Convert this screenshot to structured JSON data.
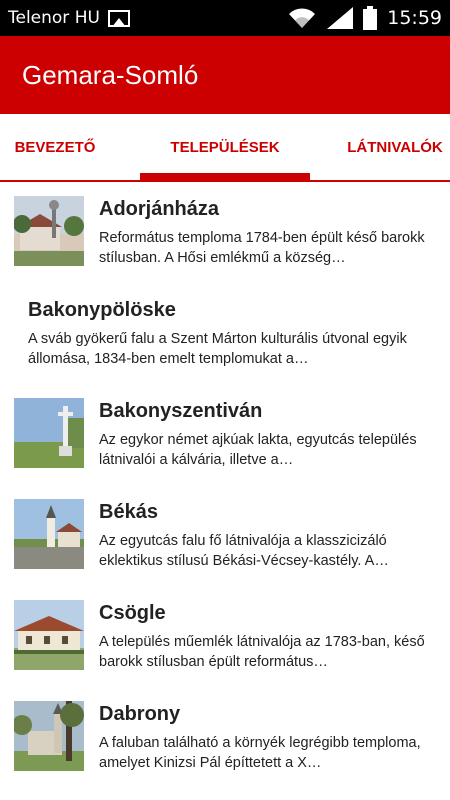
{
  "status": {
    "carrier": "Telenor HU",
    "time": "15:59"
  },
  "app": {
    "title": "Gemara-Somló"
  },
  "tabs": [
    {
      "label": "BEVEZETŐ"
    },
    {
      "label": "TELEPÜLÉSEK",
      "selected": true
    },
    {
      "label": "LÁTNIVALÓK"
    }
  ],
  "items": [
    {
      "title": "Adorjánháza",
      "desc": "Református temploma 1784-ben épült késő barokk stílusban. A Hősi emlékmű a község…"
    },
    {
      "title": "Bakonypölöske",
      "desc": "A sváb gyökerű falu a Szent Márton kulturális útvonal egyik állomása, 1834-ben emelt templomukat a…"
    },
    {
      "title": "Bakonyszentiván",
      "desc": "Az egykor német ajkúak lakta, egyutcás település látnivalói a kálvária, illetve a…"
    },
    {
      "title": "Békás",
      "desc": "Az egyutcás falu fő látnivalója a klasszicizáló eklektikus stílusú Békási-Vécsey-kastély. A…"
    },
    {
      "title": "Csögle",
      "desc": "A település műemlék látnivalója az 1783-ban, késő barokk stílusban épült református…"
    },
    {
      "title": "Dabrony",
      "desc": "A faluban található a környék legrégibb temploma, amelyet Kinizsi Pál építtetett a X…"
    }
  ],
  "colors": {
    "primary": "#cc0000",
    "status_bar": "#000000"
  },
  "icons": [
    "image-icon",
    "wifi-icon",
    "signal-icon",
    "battery-icon"
  ]
}
